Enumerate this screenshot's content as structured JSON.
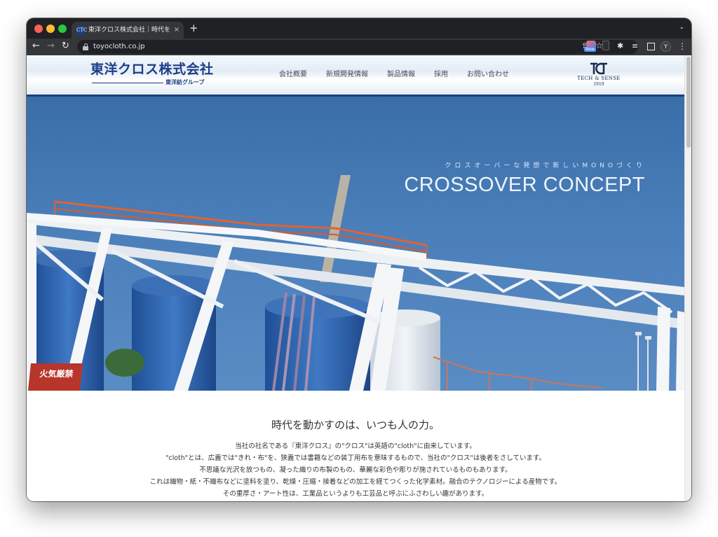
{
  "browser": {
    "tab_title": "東洋クロス株式会社｜時代を動かす",
    "tab_close": "×",
    "new_tab": "+",
    "tab_menu": "⌄",
    "url": "toyocloth.co.jp",
    "back": "←",
    "forward": "→",
    "reload": "↻",
    "share": "⇪",
    "star": "☆",
    "ext_badge": "New",
    "ext_puzzle": "✱",
    "ext_media": "≡",
    "profile_initial": "Y",
    "menu": "⋮",
    "favicon_text": "CTC"
  },
  "header": {
    "logo_main": "東洋クロス株式会社",
    "logo_sub": "東洋紡グループ",
    "nav": [
      "会社概要",
      "新規開発情報",
      "製品情報",
      "採用",
      "お問い合わせ"
    ],
    "brand_text": "TECH & SENSE",
    "brand_year": "1919"
  },
  "hero": {
    "tagline": "クロスオーバーな発想で新しいMONOづくり",
    "title": "CROSSOVER CONCEPT",
    "sign_text": "火気厳禁"
  },
  "content": {
    "heading": "時代を動かすのは、いつも人の力。",
    "paragraphs": [
      "当社の社名である『東洋クロス』の\"クロス\"は英語の\"cloth\"に由来しています。",
      "\"cloth\"とは、広義では\"きれ・布\"を、狭義では書籍などの装丁用布を意味するもので、当社の\"クロス\"は後者をさしています。",
      "不思議な光沢を放つもの、凝った織りの布製のもの、華麗な彩色や彫りが施されているものもあります。",
      "これは織物・紙・不織布などに塗料を塗り、乾燥・圧縮・接着などの加工を経てつくった化学素材。融合のテクノロジーによる産物です。",
      "その重厚さ・アート性は、工業品というよりも工芸品と呼ぶにふさわしい趣があります。"
    ]
  },
  "colors": {
    "brand_navy": "#1d3d86",
    "sky": "#4b7fba",
    "chrome_dark": "#202124"
  }
}
